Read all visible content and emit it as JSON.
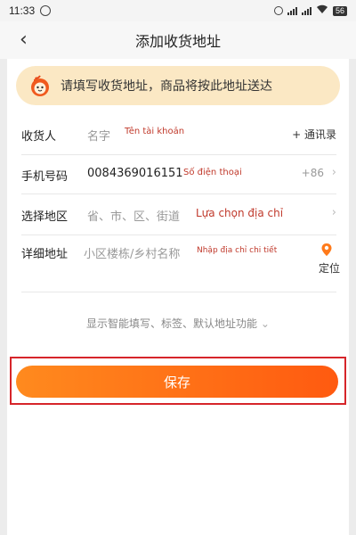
{
  "status": {
    "time": "11:33",
    "battery": "56"
  },
  "header": {
    "title": "添加收货地址"
  },
  "notice": {
    "text": "请填写收货地址，商品将按此地址送达"
  },
  "form": {
    "recipient": {
      "label": "收货人",
      "placeholder": "名字",
      "annotation": "Tên tài khoản",
      "contacts_link": "+ 通讯录"
    },
    "phone": {
      "label": "手机号码",
      "value": "0084369016151",
      "annotation": "Số điện thoại",
      "country_code": "+86"
    },
    "region": {
      "label": "选择地区",
      "placeholder": "省、市、区、街道",
      "annotation": "Lựa chọn địa chỉ"
    },
    "detail": {
      "label": "详细地址",
      "placeholder": "小区楼栋/乡村名称",
      "annotation": "Nhập địa chỉ chi tiết",
      "locate_label": "定位"
    }
  },
  "more_options": "显示智能填写、标签、默认地址功能",
  "save_label": "保存",
  "colors": {
    "accent": "#ff6a15",
    "annotation": "#c0392b",
    "highlight_border": "#d6252a",
    "notice_bg": "#fbe8c4"
  }
}
